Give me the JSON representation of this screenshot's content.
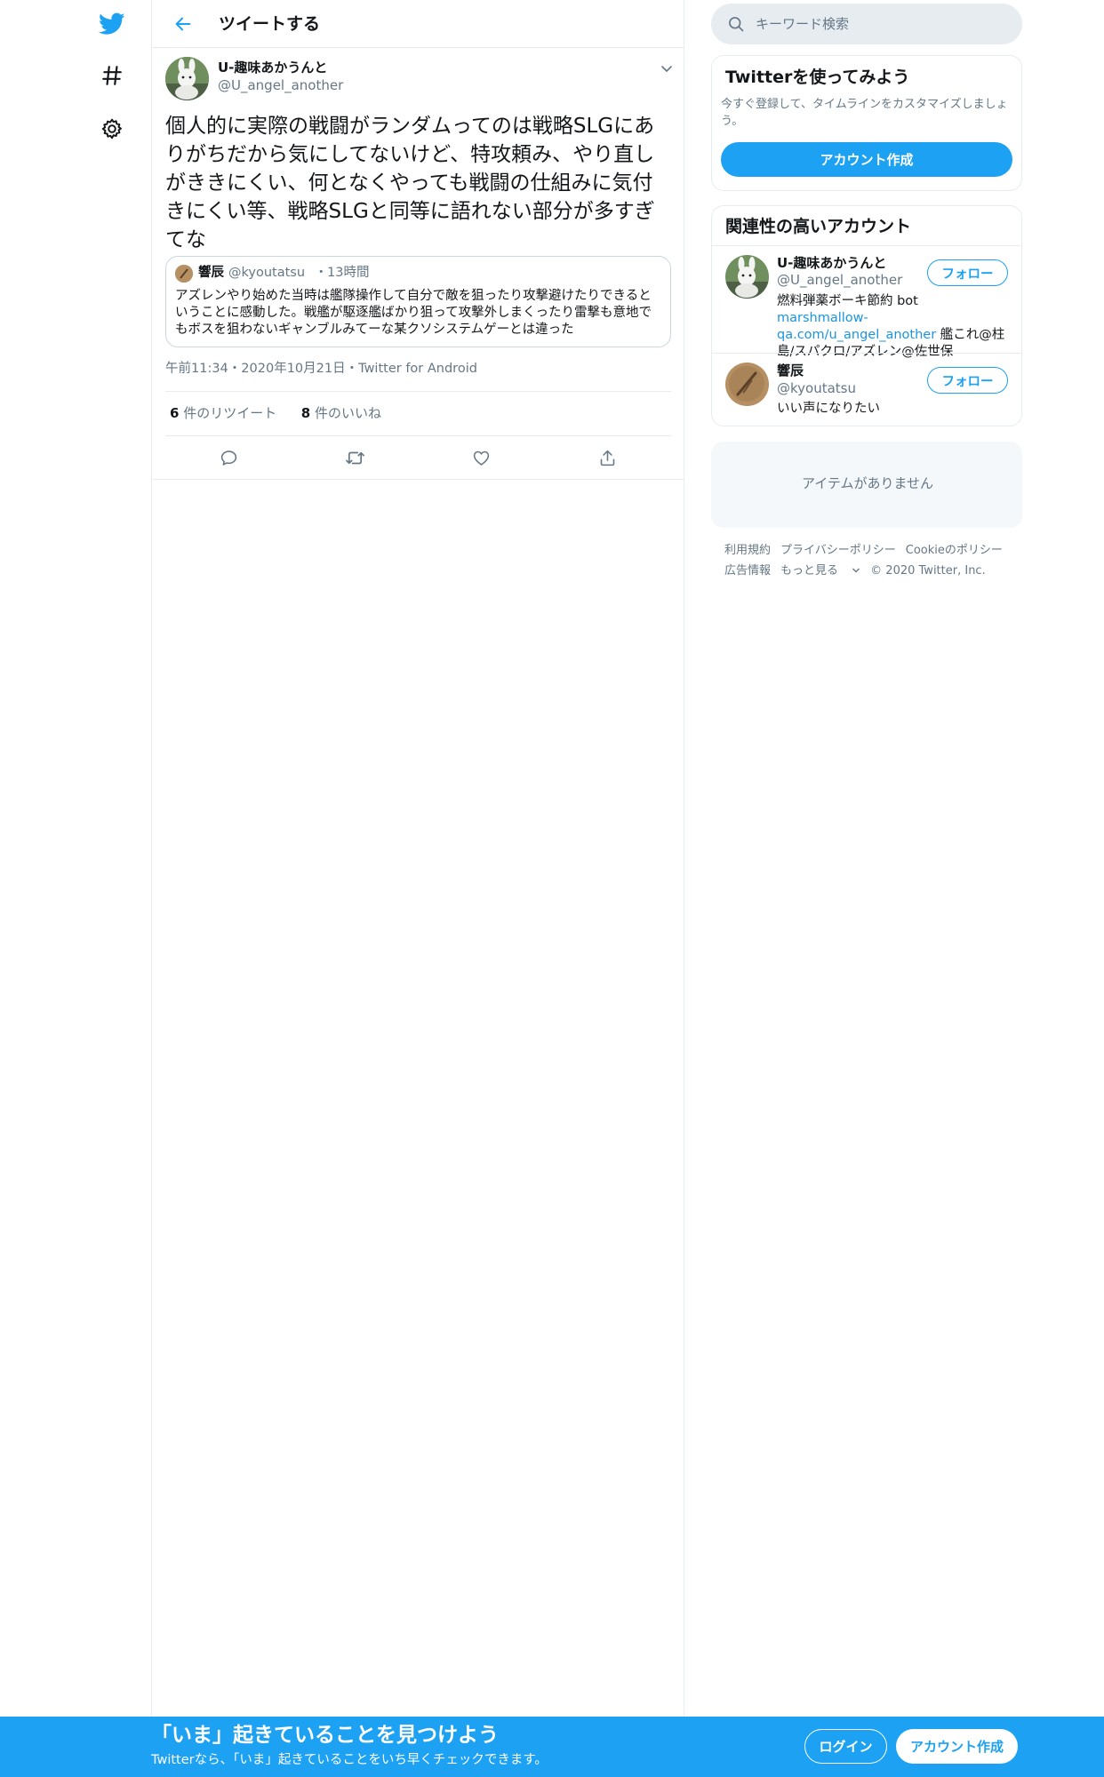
{
  "header": {
    "title": "ツイートする"
  },
  "tweet": {
    "author_name": "U-趣味あかうんと",
    "author_handle": "@U_angel_another",
    "text": "個人的に実際の戦闘がランダムってのは戦略SLGにありがちだから気にしてないけど、特攻頼み、やり直しがききにくい、何となくやっても戦闘の仕組みに気付きにくい等、戦略SLGと同等に語れない部分が多すぎてな",
    "quote": {
      "author_name": "響辰",
      "author_handle": "@kyoutatsu",
      "separator": "・",
      "time": "13時間",
      "text": "アズレンやり始めた当時は艦隊操作して自分で敵を狙ったり攻撃避けたりできるということに感動した。戦艦が駆逐艦ばかり狙って攻撃外しまくったり雷撃も意地でもボスを狙わないギャンブルみてーな某クソシステムゲーとは違った"
    },
    "time": "午前11:34",
    "sep1": "・",
    "date": "2020年10月21日",
    "sep2": "・",
    "source": "Twitter for Android",
    "retweets_count": "6",
    "retweets_label": "件のリツイート",
    "likes_count": "8",
    "likes_label": "件のいいね"
  },
  "nav": {
    "icons": [
      "twitter-logo-icon",
      "hashtag-icon",
      "settings-gear-icon"
    ]
  },
  "search": {
    "placeholder": "キーワード検索"
  },
  "signup_panel": {
    "title": "Twitterを使ってみよう",
    "description": "今すぐ登録して、タイムラインをカスタマイズしましょう。",
    "button": "アカウント作成"
  },
  "related": {
    "title": "関連性の高いアカウント",
    "accounts": [
      {
        "name": "U-趣味あかうんと",
        "handle": "@U_angel_another",
        "follow": "フォロー",
        "bio_prefix": "燃料弾薬ボーキ節約 bot ",
        "bio_link": "marshmallow-qa.com/u_angel_another",
        "bio_suffix": " 艦これ@柱島/スパクロ/アズレン@佐世保"
      },
      {
        "name": "響辰",
        "handle": "@kyoutatsu",
        "follow": "フォロー",
        "bio": "いい声になりたい"
      }
    ]
  },
  "trends_panel": {
    "empty": "アイテムがありません"
  },
  "footer": {
    "links": [
      "利用規約",
      "プライバシーポリシー",
      "Cookieのポリシー"
    ],
    "links2": [
      "広告情報",
      "もっと見る"
    ],
    "copyright": "© 2020 Twitter, Inc."
  },
  "bottom_bar": {
    "title": "「いま」起きていることを見つけよう",
    "subtitle": "Twitterなら、「いま」起きていることをいち早くチェックできます。",
    "login": "ログイン",
    "signup": "アカウント作成"
  },
  "colors": {
    "accent": "#1da1f2",
    "text": "#14171a",
    "secondary": "#657786",
    "border": "#e6ecf0"
  }
}
